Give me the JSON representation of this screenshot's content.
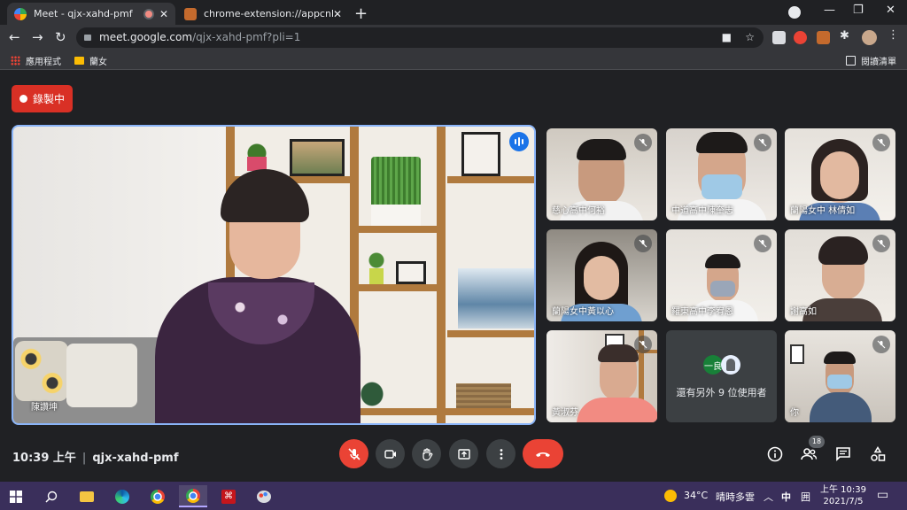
{
  "browser": {
    "tabs": [
      {
        "title": "Meet - qjx-xahd-pmf",
        "active": true
      },
      {
        "title": "chrome-extension://appcnhiefcidclcdjeahgklghghihfok",
        "active": false
      }
    ],
    "url_host": "meet.google.com",
    "url_path": "/qjx-xahd-pmf?pli=1",
    "bookmarks": [
      {
        "label": "應用程式",
        "icon": "apps-grid-icon"
      },
      {
        "label": "蘭女",
        "icon": "folder-icon"
      }
    ],
    "reading_list": "閱讀清單"
  },
  "meet": {
    "recording_label": "錄製中",
    "main_speaker": {
      "name": "陳讚坤"
    },
    "tiles": [
      {
        "name": "慈心高中何裕",
        "muted": true
      },
      {
        "name": "中道高中陳奎志",
        "muted": true
      },
      {
        "name": "蘭陽女中 林倩如",
        "muted": true
      },
      {
        "name": "蘭陽女中黃以心",
        "muted": true
      },
      {
        "name": "羅東高中李宥恩",
        "muted": true
      },
      {
        "name": "謝高如",
        "muted": true
      },
      {
        "name": "黃淑芬",
        "muted": true
      },
      {
        "name": "你",
        "muted": true
      }
    ],
    "more_users": {
      "text": "還有另外 9 位使用者",
      "avatar_letter": "一良"
    },
    "time": "10:39 上午",
    "meeting_code": "qjx-xahd-pmf",
    "participant_count": "18"
  },
  "taskbar": {
    "weather": "34°C",
    "weather_desc": "晴時多雲",
    "ime": "中",
    "clock_time": "上午 10:39",
    "clock_date": "2021/7/5"
  },
  "colors": {
    "accent_blue": "#8ab4f8",
    "record_red": "#d93025",
    "hangup_red": "#ea4335",
    "taskbar": "#3a2f5b"
  }
}
